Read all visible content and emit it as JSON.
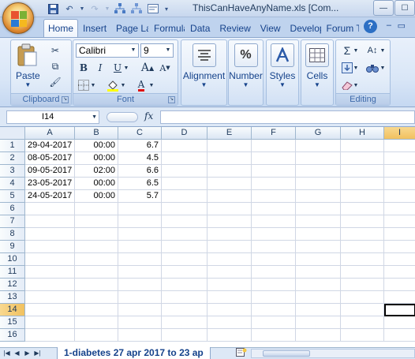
{
  "window": {
    "title": "ThisCanHaveAnyName.xls  [Com...",
    "controls": {
      "minimize": "—",
      "maximize": "☐",
      "close": "✕"
    }
  },
  "quick_access": {
    "save_icon": "save-icon",
    "undo_icon": "undo-icon",
    "redo_icon": "redo-icon"
  },
  "tabs": [
    {
      "label": "Home",
      "active": true
    },
    {
      "label": "Insert"
    },
    {
      "label": "Page La"
    },
    {
      "label": "Formula"
    },
    {
      "label": "Data"
    },
    {
      "label": "Review"
    },
    {
      "label": "View"
    },
    {
      "label": "Develop"
    },
    {
      "label": "Forum T"
    }
  ],
  "ribbon": {
    "clipboard": {
      "label": "Clipboard",
      "paste": "Paste"
    },
    "font": {
      "label": "Font",
      "name": "Calibri",
      "size": "9",
      "bold": "B",
      "italic": "I",
      "underline": "U"
    },
    "alignment": {
      "label": "Alignment"
    },
    "number": {
      "label": "Number"
    },
    "styles": {
      "label": "Styles"
    },
    "cells": {
      "label": "Cells"
    },
    "editing": {
      "label": "Editing"
    }
  },
  "formula_bar": {
    "name_box": "I14",
    "fx": "fx",
    "formula": ""
  },
  "grid": {
    "columns": [
      "A",
      "B",
      "C",
      "D",
      "E",
      "F",
      "G",
      "H",
      "I"
    ],
    "selected_column": "I",
    "selected_row": "14",
    "row_numbers": [
      "1",
      "2",
      "3",
      "4",
      "5",
      "6",
      "7",
      "8",
      "9",
      "10",
      "11",
      "12",
      "13",
      "14",
      "15",
      "16"
    ],
    "rows": [
      [
        "29-04-2017",
        "00:00",
        "6.7"
      ],
      [
        "08-05-2017",
        "00:00",
        "4.5"
      ],
      [
        "09-05-2017",
        "02:00",
        "6.6"
      ],
      [
        "23-05-2017",
        "00:00",
        "6.5"
      ],
      [
        "24-05-2017",
        "00:00",
        "5.7"
      ]
    ]
  },
  "sheet_tab": {
    "name": "1-diabetes 27 apr 2017 to 23 ap"
  }
}
